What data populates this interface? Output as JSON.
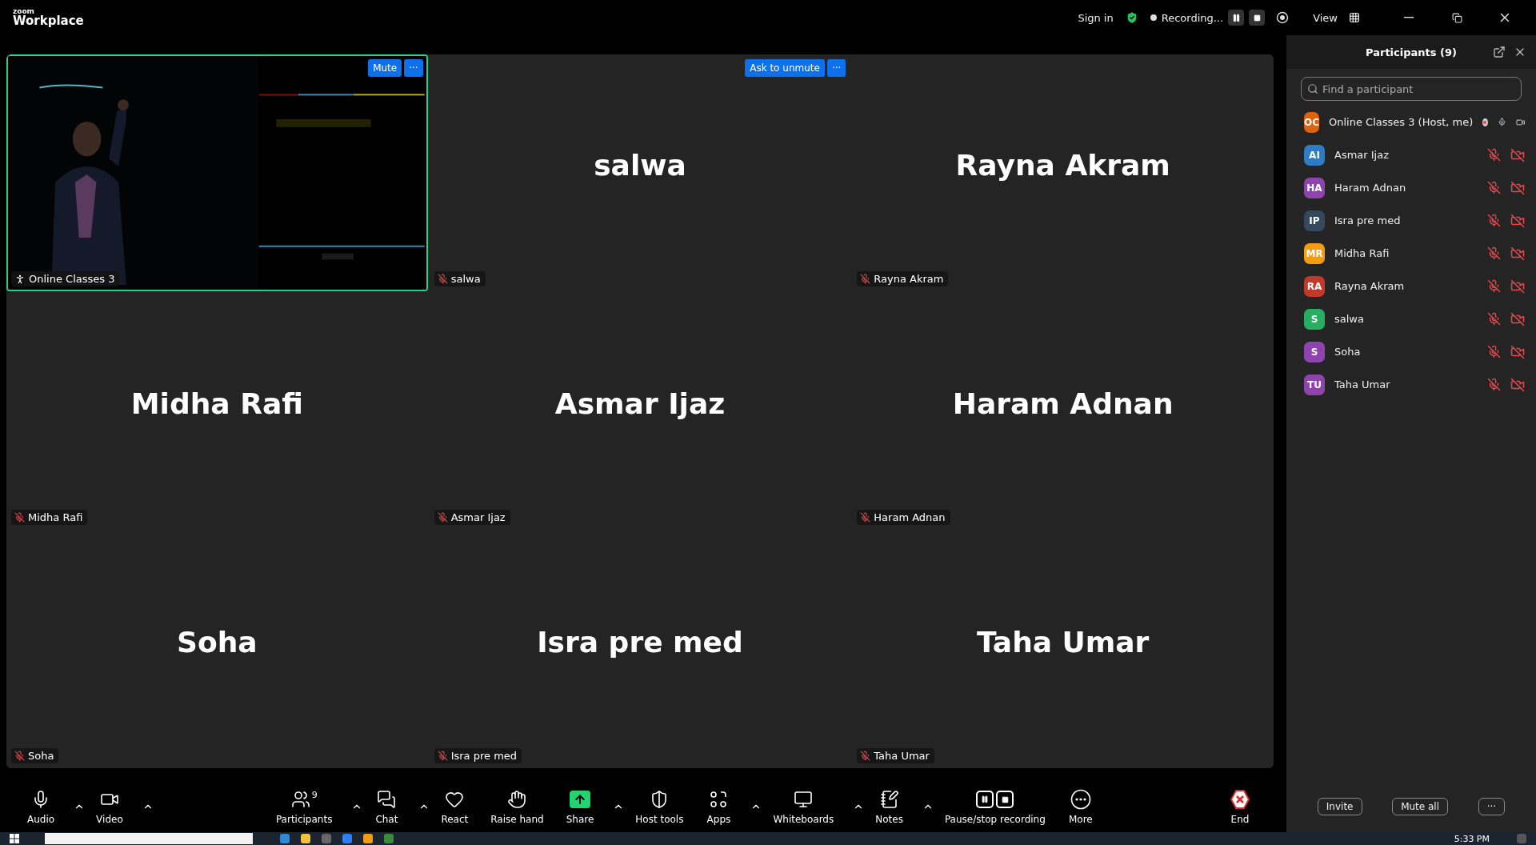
{
  "app": {
    "logo_top": "zoom",
    "logo_bottom": "Workplace"
  },
  "top_bar": {
    "sign_in": "Sign in",
    "recording": "Recording...",
    "view": "View"
  },
  "tiles": [
    {
      "kind": "video",
      "label": "Online Classes 3",
      "highlighted": true,
      "buttons": [
        "Mute",
        "···"
      ]
    },
    {
      "kind": "avatar",
      "name": "salwa",
      "label": "salwa",
      "highlighted": false,
      "muted": true,
      "buttons": [
        "Ask to unmute",
        "···"
      ]
    },
    {
      "kind": "avatar",
      "name": "Rayna Akram",
      "label": "Rayna Akram",
      "highlighted": false,
      "muted": true
    },
    {
      "kind": "avatar",
      "name": "Midha Rafi",
      "label": "Midha Rafi",
      "highlighted": false,
      "muted": true
    },
    {
      "kind": "avatar",
      "name": "Asmar Ijaz",
      "label": "Asmar Ijaz",
      "highlighted": false,
      "muted": true
    },
    {
      "kind": "avatar",
      "name": "Haram Adnan",
      "label": "Haram Adnan",
      "highlighted": false,
      "muted": true
    },
    {
      "kind": "avatar",
      "name": "Soha",
      "label": "Soha",
      "highlighted": false,
      "muted": true
    },
    {
      "kind": "avatar",
      "name": "Isra pre med",
      "label": "Isra pre med",
      "highlighted": false,
      "muted": true
    },
    {
      "kind": "avatar",
      "name": "Taha Umar",
      "label": "Taha Umar",
      "highlighted": false,
      "muted": true
    }
  ],
  "toolbar": [
    {
      "kind": "audio",
      "label": "Audio",
      "caret": true
    },
    {
      "kind": "video",
      "label": "Video",
      "caret": true
    },
    {
      "kind": "spacer"
    },
    {
      "kind": "participants",
      "label": "Participants",
      "badge": "9",
      "caret": true
    },
    {
      "kind": "chat",
      "label": "Chat",
      "caret": true
    },
    {
      "kind": "react",
      "label": "React",
      "caret": false
    },
    {
      "kind": "hand",
      "label": "Raise hand",
      "caret": false
    },
    {
      "kind": "share",
      "label": "Share",
      "caret": true
    },
    {
      "kind": "host",
      "label": "Host tools",
      "caret": false
    },
    {
      "kind": "apps",
      "label": "Apps",
      "caret": true
    },
    {
      "kind": "whiteboards",
      "label": "Whiteboards",
      "caret": true
    },
    {
      "kind": "notes",
      "label": "Notes",
      "caret": true
    },
    {
      "kind": "recording",
      "label": "Pause/stop recording",
      "caret": false
    },
    {
      "kind": "more",
      "label": "More",
      "caret": false
    },
    {
      "kind": "spacer"
    },
    {
      "kind": "end",
      "label": "End",
      "caret": false
    }
  ],
  "participants_panel": {
    "title": "Participants (9)",
    "search": {
      "placeholder": "Find a participant"
    },
    "participants": [
      {
        "initials": "OC",
        "name": "Online Classes 3 (Host, me)",
        "color": "#e0620d",
        "recording": true,
        "muted": false,
        "video_off": false
      },
      {
        "initials": "AI",
        "name": "Asmar Ijaz",
        "color": "#2e7cc4",
        "recording": false,
        "muted": true,
        "video_off": true
      },
      {
        "initials": "HA",
        "name": "Haram Adnan",
        "color": "#8e44ad",
        "recording": false,
        "muted": true,
        "video_off": true
      },
      {
        "initials": "IP",
        "name": "Isra pre med",
        "color": "#34495e",
        "recording": false,
        "muted": true,
        "video_off": true
      },
      {
        "initials": "MR",
        "name": "Midha Rafi",
        "color": "#f39c12",
        "recording": false,
        "muted": true,
        "video_off": true
      },
      {
        "initials": "RA",
        "name": "Rayna Akram",
        "color": "#c0392b",
        "recording": false,
        "muted": true,
        "video_off": true
      },
      {
        "initials": "S",
        "name": "salwa",
        "color": "#27ae60",
        "recording": false,
        "muted": true,
        "video_off": true
      },
      {
        "initials": "S",
        "name": "Soha",
        "color": "#8e44ad",
        "recording": false,
        "muted": true,
        "video_off": true
      },
      {
        "initials": "TU",
        "name": "Taha Umar",
        "color": "#8e44ad",
        "recording": false,
        "muted": true,
        "video_off": true
      }
    ],
    "footer_buttons": [
      "Invite",
      "Mute all",
      "···"
    ]
  },
  "taskbar": {
    "clock": "5:33 PM"
  }
}
